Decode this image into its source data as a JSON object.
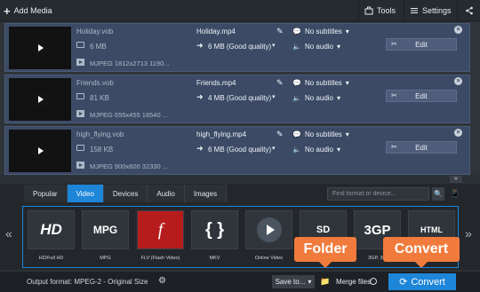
{
  "toolbar": {
    "add_media_label": "Add Media",
    "tools_label": "Tools",
    "settings_label": "Settings"
  },
  "files": [
    {
      "source_name": "Holiday.vob",
      "source_size": "6 MB",
      "source_info": "MJPEG 1812x2713 1190...",
      "output_name": "Holiday.mp4",
      "output_quality": "6 MB (Good quality)",
      "subtitles": "No subtitles",
      "audio": "No audio",
      "edit_label": "Edit"
    },
    {
      "source_name": "Friends.vob",
      "source_size": "81 KB",
      "source_info": "MJPEG 655x455 16540 ...",
      "output_name": "Friends.mp4",
      "output_quality": "4 MB (Good quality)",
      "subtitles": "No subtitles",
      "audio": "No audio",
      "edit_label": "Edit"
    },
    {
      "source_name": "high_flying.vob",
      "source_size": "158 KB",
      "source_info": "MJPEG 900x600 32330 ...",
      "output_name": "high_flying.mp4",
      "output_quality": "6 MB (Good quality)",
      "subtitles": "No subtitles",
      "audio": "No audio",
      "edit_label": "Edit"
    }
  ],
  "format_tabs": [
    "Popular",
    "Video",
    "Devices",
    "Audio",
    "Images"
  ],
  "active_tab": "Video",
  "search": {
    "placeholder": "Find format or device..."
  },
  "formats": [
    {
      "tile": "HD",
      "label": "HD/Full HD",
      "icon": "hd-video-icon"
    },
    {
      "tile": "MPG",
      "label": "MPG",
      "icon": "mpg-icon"
    },
    {
      "tile": "f",
      "label": "FLV (Flash Video)",
      "icon": "flash-icon"
    },
    {
      "tile": "{ }",
      "label": "MKV",
      "icon": "mkv-icon"
    },
    {
      "tile": "",
      "label": "Online Video",
      "icon": "online-video-icon"
    },
    {
      "tile": "SD",
      "label": "",
      "icon": "sd-video-icon"
    },
    {
      "tile": "3GP",
      "label": "3GP, 3G",
      "icon": "3gp-icon"
    },
    {
      "tile": "HTML",
      "label": "",
      "icon": "html5-icon"
    }
  ],
  "callouts": {
    "folder": "Folder",
    "convert": "Convert"
  },
  "bottom": {
    "output_format_label": "Output format: MPEG-2 - Original Size",
    "save_to_label": "Save to...",
    "merge_files_label": "Merge files:",
    "convert_label": "Convert"
  },
  "colors": {
    "accent": "#1e86d9",
    "callout": "#f07b3c",
    "item_bg": "#3c4a66"
  }
}
